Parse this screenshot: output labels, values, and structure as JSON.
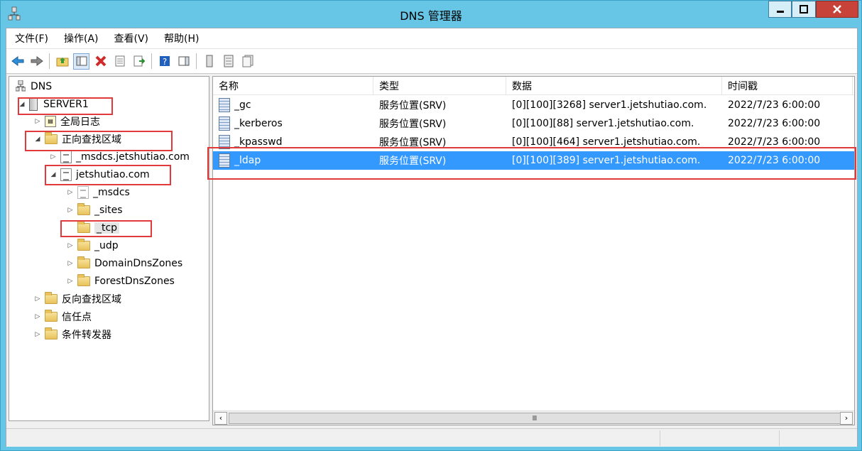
{
  "window": {
    "title": "DNS 管理器"
  },
  "menu": [
    "文件(F)",
    "操作(A)",
    "查看(V)",
    "帮助(H)"
  ],
  "tree": {
    "root": "DNS",
    "server": "SERVER1",
    "global_logs": "全局日志",
    "forward_zones": "正向查找区域",
    "msdcs_zone": "_msdcs.jetshutiao.com",
    "domain_zone": "jetshutiao.com",
    "children": [
      "_msdcs",
      "_sites",
      "_tcp",
      "_udp",
      "DomainDnsZones",
      "ForestDnsZones"
    ],
    "reverse_zones": "反向查找区域",
    "trust_points": "信任点",
    "conditional_forwarders": "条件转发器"
  },
  "list": {
    "columns": [
      "名称",
      "类型",
      "数据",
      "时间戳"
    ],
    "rows": [
      {
        "name": "_gc",
        "type": "服务位置(SRV)",
        "data": "[0][100][3268] server1.jetshutiao.com.",
        "timestamp": "2022/7/23 6:00:00"
      },
      {
        "name": "_kerberos",
        "type": "服务位置(SRV)",
        "data": "[0][100][88] server1.jetshutiao.com.",
        "timestamp": "2022/7/23 6:00:00"
      },
      {
        "name": "_kpasswd",
        "type": "服务位置(SRV)",
        "data": "[0][100][464] server1.jetshutiao.com.",
        "timestamp": "2022/7/23 6:00:00"
      },
      {
        "name": "_ldap",
        "type": "服务位置(SRV)",
        "data": "[0][100][389] server1.jetshutiao.com.",
        "timestamp": "2022/7/23 6:00:00"
      }
    ],
    "selected_index": 3
  },
  "colors": {
    "selection": "#3399ff",
    "highlight_box": "#e23a3a",
    "titlebar": "#67c6e6"
  }
}
